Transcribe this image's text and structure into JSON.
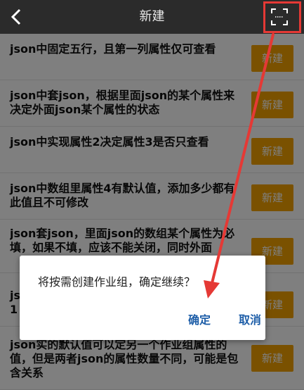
{
  "header": {
    "back_icon": "chevron-left-icon",
    "title": "新建",
    "scan_icon": "scan-icon"
  },
  "rows": [
    {
      "text": "json中固定五行，且第一列属性仅可查看",
      "button": "新建"
    },
    {
      "text": "json中套json，根据里面json的某个属性来决定外面json某个属性的状态",
      "button": "新建"
    },
    {
      "text": "json中实现属性2决定属性3是否只查看",
      "button": "新建"
    },
    {
      "text": "json中数组里属性4有默认值，添加多少都有此值且不可修改",
      "button": "新建"
    },
    {
      "text": "json套json，里面json的数组某个属性为必填，如果不填，应该不能关闭，同时外面",
      "button": "新建"
    },
    {
      "text": "js",
      "button": "新建",
      "line2": "1"
    },
    {
      "text": "json实的默认值可以定另一个作业组属性的值，但是两者json的属性数量不同，可能是包含关系",
      "button": "新建"
    }
  ],
  "dialog": {
    "message": "将按需创建作业组，确定继续？",
    "ok": "确定",
    "cancel": "取消"
  },
  "colors": {
    "header_bg": "#2b2b2b",
    "accent": "#f5a300",
    "dialog_button": "#1e5ea8",
    "annotation": "#e53935"
  }
}
